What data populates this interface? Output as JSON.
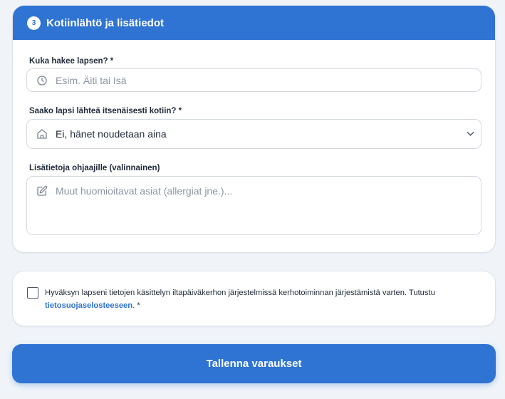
{
  "section": {
    "step_number": "3",
    "title": "Kotiinlähtö ja lisätiedot"
  },
  "fields": {
    "pickup": {
      "label": "Kuka hakee lapsen? *",
      "placeholder": "Esim. Äiti tai Isä",
      "icon": "clock-icon"
    },
    "independent": {
      "label": "Saako lapsi lähteä itsenäisesti kotiin? *",
      "selected": "Ei, hänet noudetaan aina",
      "icon": "home-icon"
    },
    "notes": {
      "label": "Lisätietoja ohjaajille (valinnainen)",
      "placeholder": "Muut huomioitavat asiat (allergiat jne.)...",
      "icon": "edit-icon"
    }
  },
  "consent": {
    "text": "Hyväksyn lapseni tietojen käsittelyn iltapäiväkerhon järjestelmissä kerhotoiminnan järjestämistä varten. Tutustu",
    "link_text": "tietosuojaselosteeseen",
    "suffix": ". *"
  },
  "submit": {
    "label": "Tallenna varaukset"
  },
  "colors": {
    "accent": "#2f73d3",
    "background": "#f0f4f9"
  }
}
